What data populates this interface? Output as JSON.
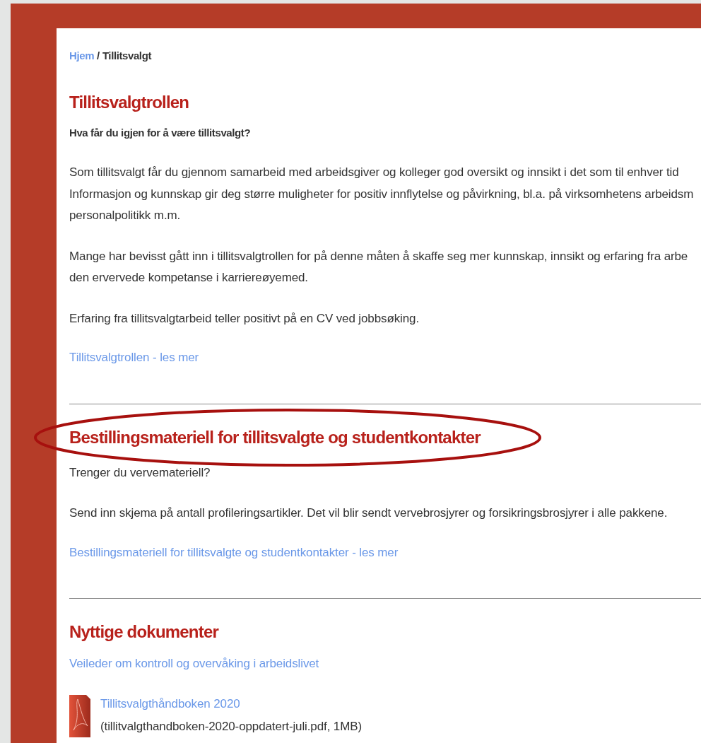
{
  "breadcrumb": [
    {
      "label": "Hjem",
      "kind": "link"
    },
    {
      "label": "/",
      "kind": "separator"
    },
    {
      "label": "Tillitsvalgt",
      "kind": "current"
    }
  ],
  "sections": [
    {
      "heading": "Tillitsvalgtrollen",
      "blocks": [
        {
          "kind": "lead",
          "text": "Hva får du igjen for å være tillitsvalgt?"
        },
        {
          "kind": "paragraph",
          "lines": [
            "Som tillitsvalgt får du gjennom samarbeid med arbeidsgiver og kolleger god oversikt og innsikt i det som til enhver tid",
            "Informasjon og kunnskap gir deg større muligheter for positiv innflytelse og påvirkning, bl.a. på virksomhetens arbeidsm",
            "personalpolitikk m.m."
          ]
        },
        {
          "kind": "paragraph",
          "lines": [
            "Mange har bevisst gått inn i tillitsvalgtrollen for på denne måten å skaffe seg mer kunnskap, innsikt og erfaring fra arbe",
            "den ervervede kompetanse i karriereøyemed."
          ]
        },
        {
          "kind": "paragraph",
          "lines": [
            "Erfaring fra tillitsvalgtarbeid teller positivt på en CV ved jobbsøking."
          ]
        },
        {
          "kind": "link",
          "text": "Tillitsvalgtrollen - les mer"
        }
      ]
    },
    {
      "heading": "Bestillingsmateriell for tillitsvalgte og studentkontakter",
      "annotation": {
        "kind": "ellipse"
      },
      "blocks": [
        {
          "kind": "paragraph",
          "lines": [
            "Trenger du vervemateriell?"
          ]
        },
        {
          "kind": "paragraph",
          "lines": [
            "Send inn skjema på antall profileringsartikler. Det vil blir sendt vervebrosjyrer og forsikringsbrosjyrer i alle pakkene."
          ]
        },
        {
          "kind": "link",
          "text": "Bestillingsmateriell for tillitsvalgte og studentkontakter - les mer"
        }
      ]
    },
    {
      "heading": "Nyttige dokumenter",
      "blocks": [
        {
          "kind": "link",
          "text": "Veileder om kontroll og overvåking i arbeidslivet"
        },
        {
          "kind": "file",
          "title": "Tillitsvalgthåndboken 2020",
          "details": "(tillitvalgthandboken-2020-oppdatert-juli.pdf, 1MB)"
        }
      ]
    }
  ]
}
